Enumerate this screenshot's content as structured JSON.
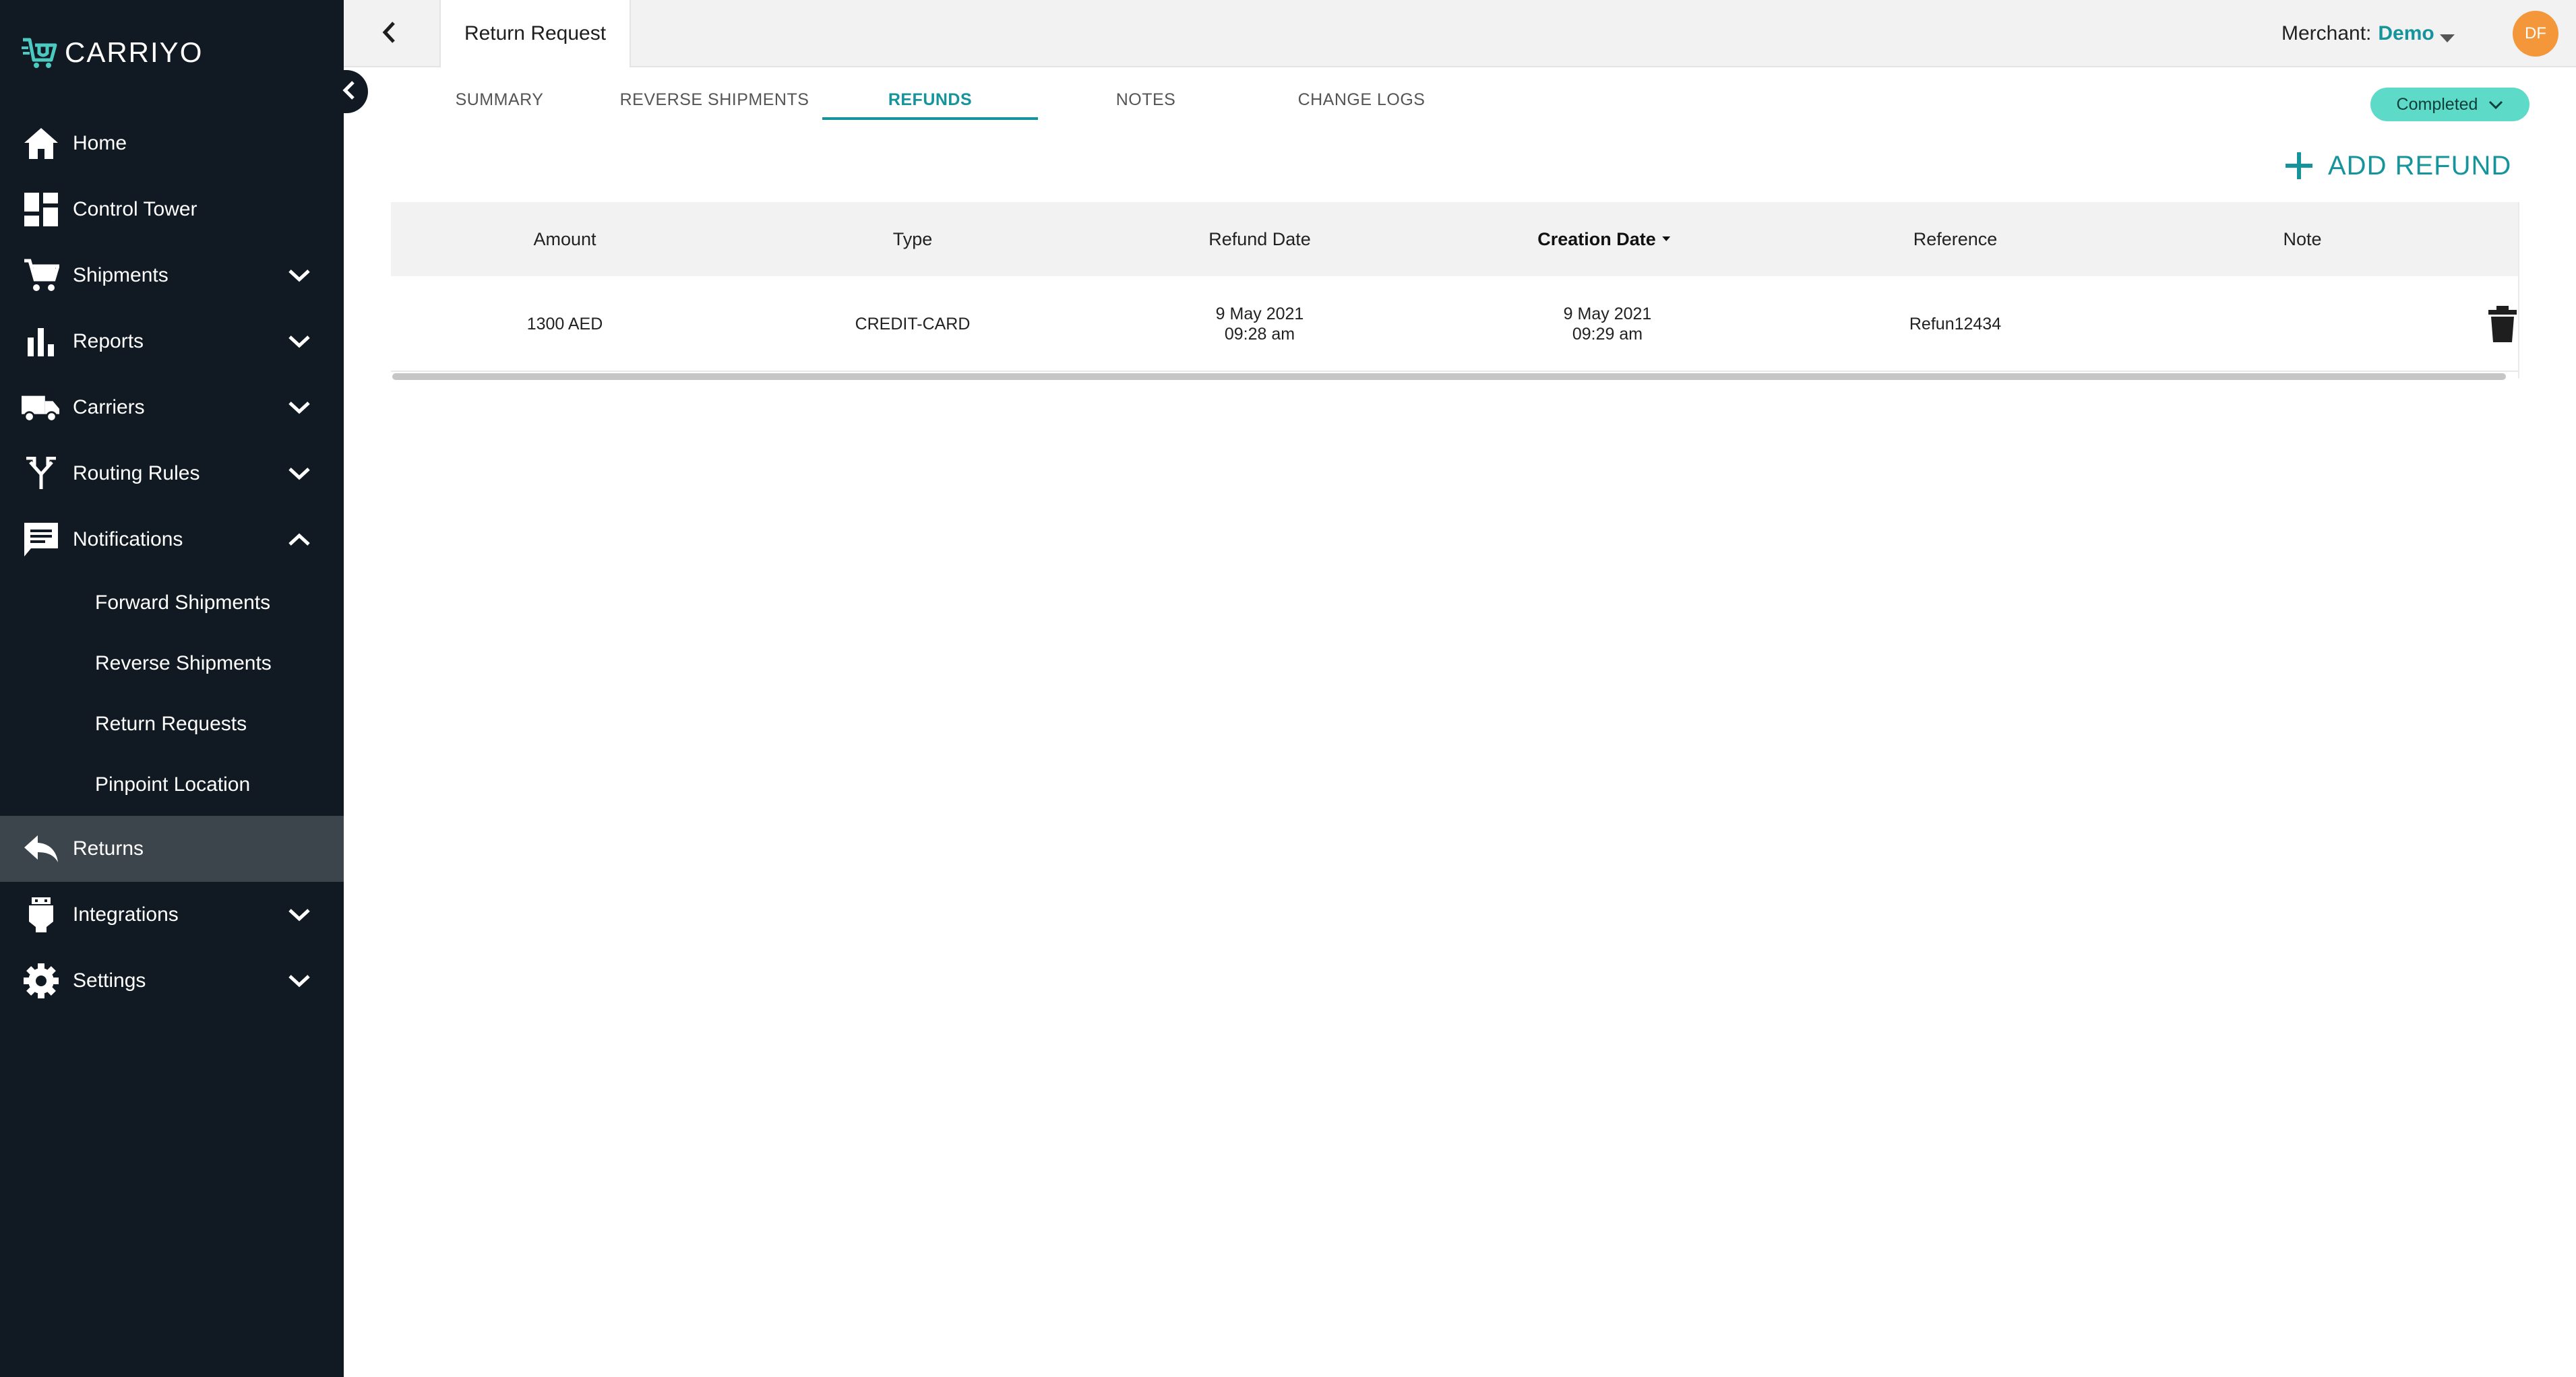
{
  "app": {
    "logo_text": "CARRIYO"
  },
  "sidebar": {
    "items": [
      {
        "label": "Home",
        "icon": "home-icon"
      },
      {
        "label": "Control Tower",
        "icon": "dashboard-icon"
      },
      {
        "label": "Shipments",
        "icon": "cart-icon"
      },
      {
        "label": "Reports",
        "icon": "bar-chart-icon"
      },
      {
        "label": "Carriers",
        "icon": "truck-icon"
      },
      {
        "label": "Routing Rules",
        "icon": "fork-icon"
      },
      {
        "label": "Notifications",
        "icon": "message-icon"
      },
      {
        "label": "Returns",
        "icon": "reply-icon"
      },
      {
        "label": "Integrations",
        "icon": "plug-icon"
      },
      {
        "label": "Settings",
        "icon": "gear-icon"
      }
    ],
    "notifications_sub": [
      {
        "label": "Forward Shipments"
      },
      {
        "label": "Reverse Shipments"
      },
      {
        "label": "Return Requests"
      },
      {
        "label": "Pinpoint Location"
      }
    ]
  },
  "header": {
    "page_tab": "Return Request",
    "merchant_label": "Merchant:",
    "merchant_value": "Demo",
    "avatar_initials": "DF"
  },
  "tabs": [
    {
      "label": "SUMMARY"
    },
    {
      "label": "REVERSE SHIPMENTS"
    },
    {
      "label": "REFUNDS"
    },
    {
      "label": "NOTES"
    },
    {
      "label": "CHANGE LOGS"
    }
  ],
  "status": {
    "label": "Completed"
  },
  "actions": {
    "add_refund": "ADD REFUND"
  },
  "table": {
    "columns": [
      "Amount",
      "Type",
      "Refund Date",
      "Creation Date",
      "Reference",
      "Note"
    ],
    "rows": [
      {
        "amount": "1300 AED",
        "type": "CREDIT-CARD",
        "refund_date": "9 May 2021",
        "refund_time": "09:28 am",
        "creation_date": "9 May 2021",
        "creation_time": "09:29 am",
        "reference": "Refun12434",
        "note": ""
      }
    ]
  },
  "colors": {
    "sidebar_bg": "#111a22",
    "accent": "#16949c",
    "status_bg": "#5edac8",
    "avatar_bg": "#f3973a"
  }
}
